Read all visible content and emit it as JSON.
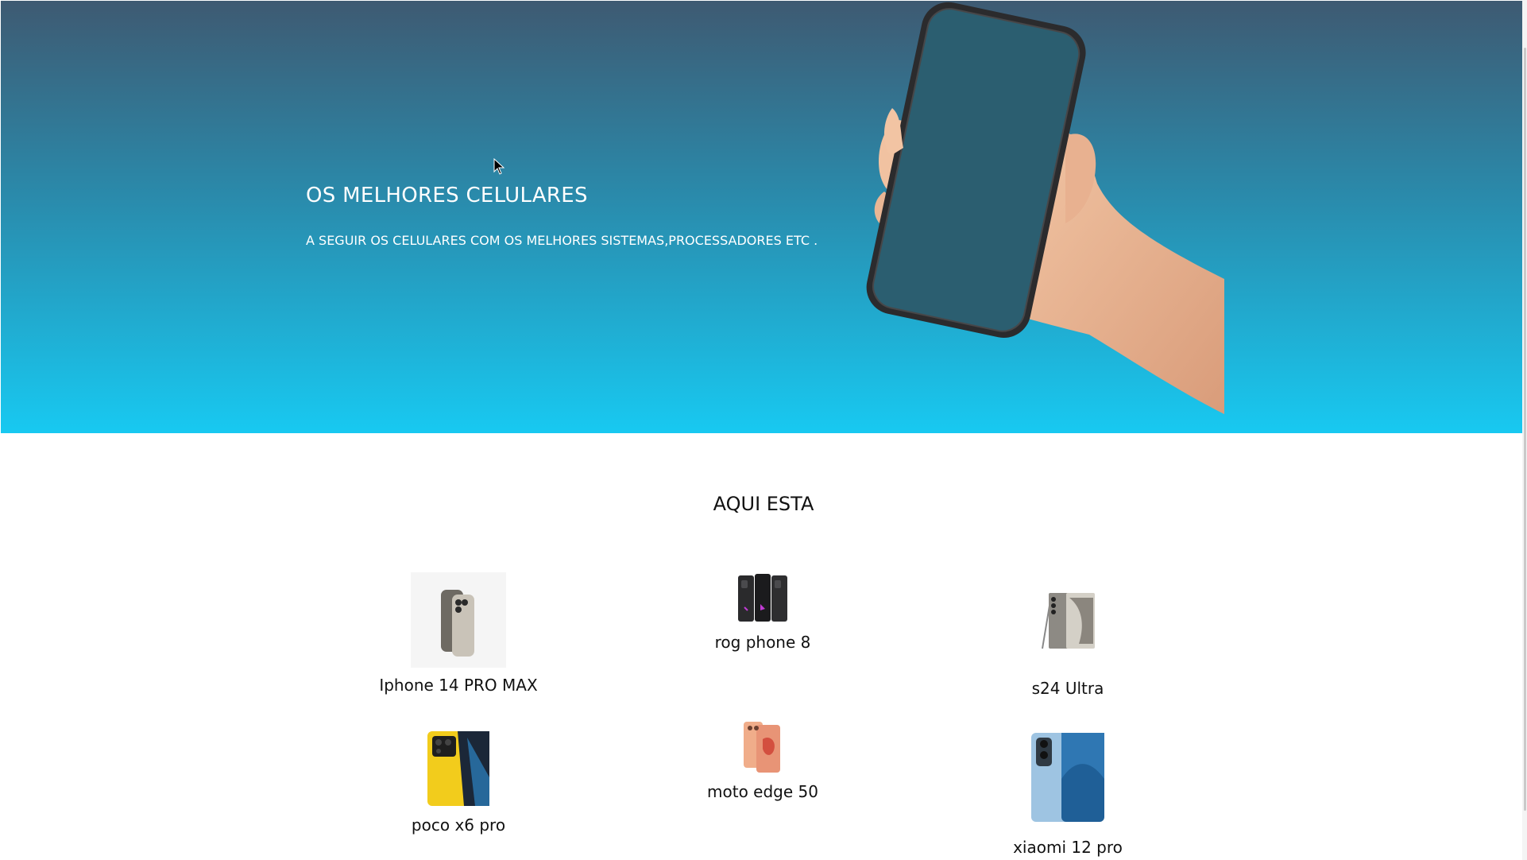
{
  "hero": {
    "title": "OS MELHORES CELULARES",
    "subtitle": "A SEGUIR OS CELULARES COM OS MELHORES SISTEMAS,PROCESSADORES ETC ."
  },
  "products": {
    "heading": "AQUI ESTA",
    "items": [
      {
        "name": "Iphone 14 PRO MAX"
      },
      {
        "name": "rog phone 8"
      },
      {
        "name": "s24 Ultra"
      },
      {
        "name": "poco x6 pro"
      },
      {
        "name": "moto edge 50"
      },
      {
        "name": "xiaomi 12 pro"
      }
    ]
  },
  "colors": {
    "hero_top": "#3e5a72",
    "hero_bottom": "#18c9f1",
    "text_dark": "#111111",
    "text_light": "#ffffff"
  },
  "icons": [
    "hand-holding-phone-image",
    "mouse-cursor-icon"
  ]
}
